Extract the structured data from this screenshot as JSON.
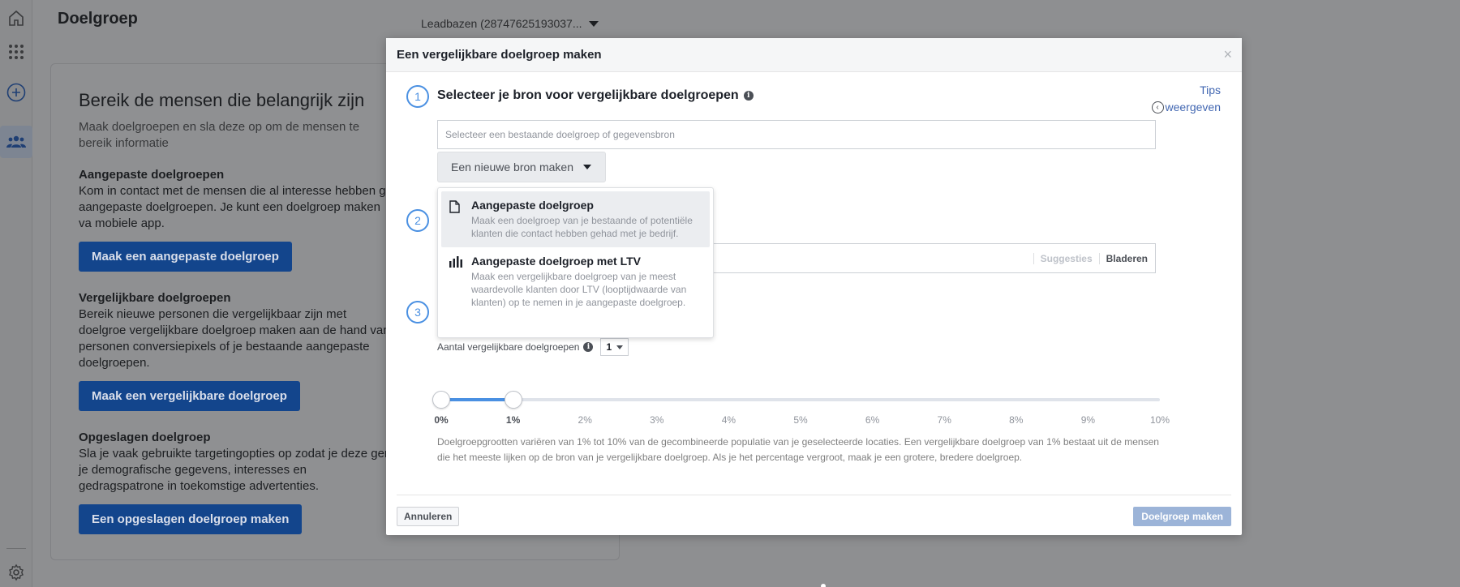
{
  "page": {
    "title": "Doelgroep",
    "account": "Leadbazen (28747625193037..."
  },
  "rail": {
    "icons": [
      "home-icon",
      "apps-grid-icon",
      "add-circle-icon",
      "audience-people-icon",
      "settings-gear-icon"
    ]
  },
  "card": {
    "heading": "Bereik de mensen die belangrijk zijn",
    "subtitle": "Maak doelgroepen en sla deze op om de mensen te bereik informatie",
    "sections": [
      {
        "title": "Aangepaste doelgroepen",
        "text": "Kom in contact met de mensen die al interesse hebben ge aangepaste doelgroepen. Je kunt een doelgroep maken va mobiele app.",
        "button": "Maak een aangepaste doelgroep"
      },
      {
        "title": "Vergelijkbare doelgroepen",
        "text": "Bereik nieuwe personen die vergelijkbaar zijn met doelgroe vergelijkbare doelgroep maken aan de hand van personen conversiepixels of je bestaande aangepaste doelgroepen.",
        "button": "Maak een vergelijkbare doelgroep"
      },
      {
        "title": "Opgeslagen doelgroep",
        "text": "Sla je vaak gebruikte targetingopties op zodat je deze gem je demografische gegevens, interesses en gedragspatrone in toekomstige advertenties.",
        "button": "Een opgeslagen doelgroep maken"
      }
    ]
  },
  "modal": {
    "title": "Een vergelijkbare doelgroep maken",
    "close": "×",
    "tips_line1": "Tips",
    "tips_line2": "weergeven",
    "steps": [
      "1",
      "2",
      "3"
    ],
    "step1_title": "Selecteer je bron voor vergelijkbare doelgroepen",
    "source_placeholder": "Selecteer een bestaande doelgroep of gegevensbron",
    "new_source_button": "Een nieuwe bron maken",
    "dropdown": [
      {
        "title": "Aangepaste doelgroep",
        "desc": "Maak een doelgroep van je bestaande of potentiële klanten die contact hebben gehad met je bedrijf.",
        "icon": "document-icon"
      },
      {
        "title": "Aangepaste doelgroep met LTV",
        "desc": "Maak een vergelijkbare doelgroep van je meest waardevolle klanten door LTV (looptijdwaarde van klanten) op te nemen in je aangepaste doelgroep.",
        "icon": "bar-chart-icon"
      }
    ],
    "location_suggestions": "Suggesties",
    "location_browse": "Bladeren",
    "count_label": "Aantal vergelijkbare doelgroepen",
    "count_value": "1",
    "slider": {
      "min": 0,
      "max": 10,
      "value": 1,
      "ticks": [
        "0%",
        "1%",
        "2%",
        "3%",
        "4%",
        "5%",
        "6%",
        "7%",
        "8%",
        "9%",
        "10%"
      ]
    },
    "help_text": "Doelgroepgrootten variëren van 1% tot 10% van de gecombineerde populatie van je geselecteerde locaties. Een vergelijkbare doelgroep van 1% bestaat uit de mensen die het meeste lijken op de bron van je vergelijkbare doelgroep. Als je het percentage vergroot, maak je een grotere, bredere doelgroep.",
    "cancel_button": "Annuleren",
    "create_button": "Doelgroep maken"
  },
  "colors": {
    "accent": "#4a90e2",
    "brand_blue": "#1a5bbf",
    "link": "#4267b2"
  }
}
